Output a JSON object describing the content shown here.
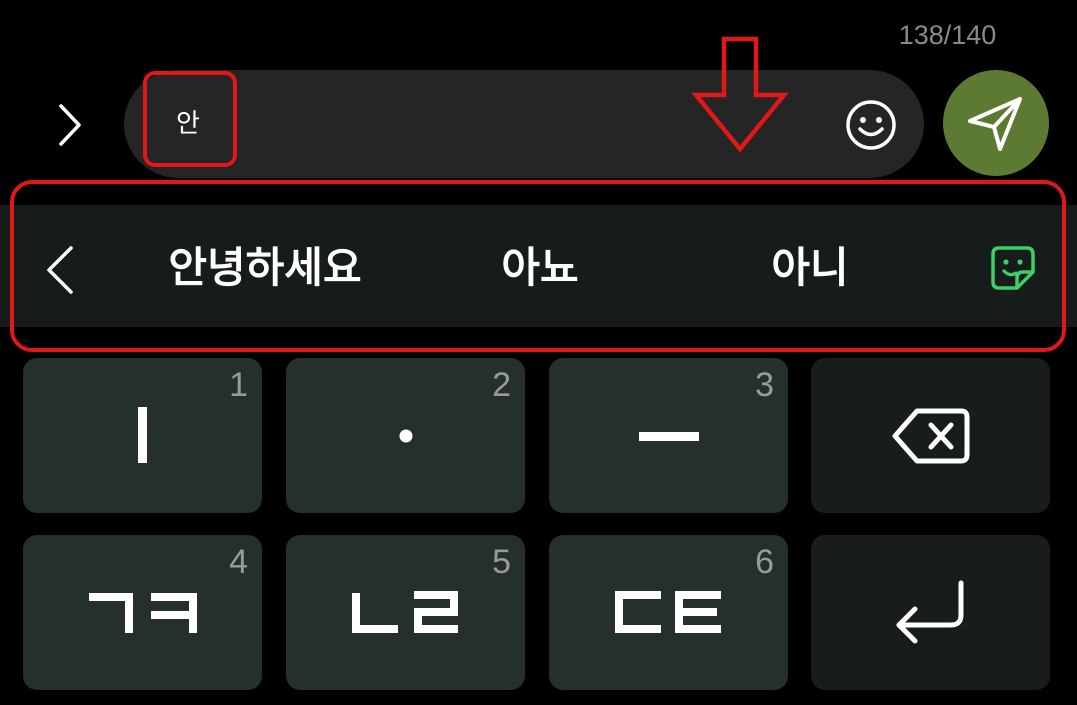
{
  "header": {
    "char_count": "138/140"
  },
  "composer": {
    "text": "안",
    "expand_icon": "chevron-right-icon",
    "emoji_icon": "smiley-icon",
    "send_icon": "send-icon",
    "send_color": "#5d7a33"
  },
  "suggestions": {
    "back_icon": "chevron-left-icon",
    "items": [
      "안녕하세요",
      "아뇨",
      "아니"
    ],
    "sticker_icon": "sticker-icon",
    "sticker_color": "#3fcf6a"
  },
  "keyboard": {
    "keys": [
      {
        "id": "key-1",
        "label": "ㅣ",
        "num": "1"
      },
      {
        "id": "key-2",
        "label": "·",
        "num": "2"
      },
      {
        "id": "key-3",
        "label": "ㅡ",
        "num": "3"
      },
      {
        "id": "key-backspace",
        "label": "",
        "icon": "backspace-icon"
      },
      {
        "id": "key-4",
        "label": "ㄱㅋ",
        "num": "4"
      },
      {
        "id": "key-5",
        "label": "ㄴㄹ",
        "num": "5"
      },
      {
        "id": "key-6",
        "label": "ㄷㅌ",
        "num": "6"
      },
      {
        "id": "key-enter",
        "label": "",
        "icon": "enter-icon"
      }
    ]
  },
  "annotations": {
    "color": "#e01818"
  }
}
